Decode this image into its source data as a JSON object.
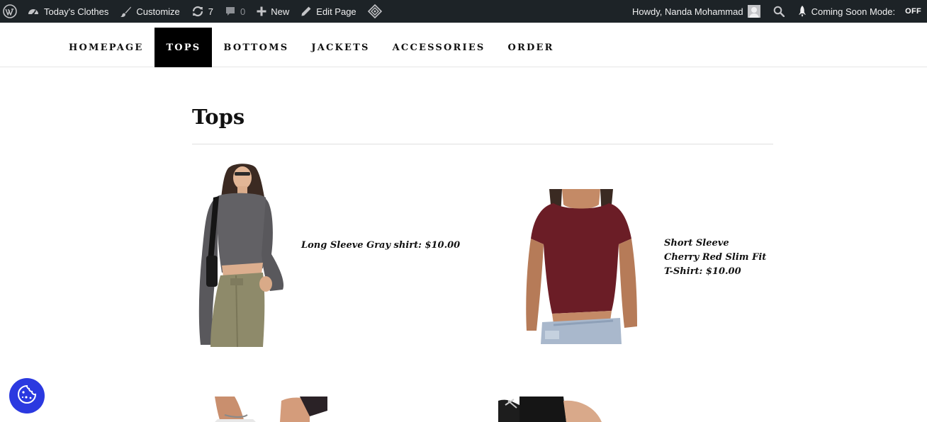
{
  "adminbar": {
    "wp_logo_icon": "wordpress-logo-icon",
    "site_name": "Today's Clothes",
    "customize": "Customize",
    "updates_count": "7",
    "comments_count": "0",
    "new_label": "New",
    "edit_page": "Edit Page",
    "greeting": "Howdy, Nanda Mohammad",
    "coming_soon": "Coming Soon Mode:",
    "coming_soon_state": "OFF",
    "colors": {
      "bar_bg": "#1d2327",
      "text": "#f0f0f1"
    }
  },
  "nav": {
    "items": [
      {
        "label": "HOMEPAGE",
        "active": false
      },
      {
        "label": "TOPS",
        "active": true
      },
      {
        "label": "BOTTOMS",
        "active": false
      },
      {
        "label": "JACKETS",
        "active": false
      },
      {
        "label": "ACCESSORIES",
        "active": false
      },
      {
        "label": "ORDER",
        "active": false
      }
    ]
  },
  "page": {
    "title": "Tops"
  },
  "products": [
    {
      "caption": "Long Sleeve Gray shirt: $10.00",
      "image": "model in long sleeve gray shirt and olive cargo pants"
    },
    {
      "caption": "Short Sleeve Cherry Red Slim Fit T-Shirt: $10.00",
      "image": "model in cherry red slim fit t-shirt and denim"
    },
    {
      "caption": "",
      "image": "model in white top (partially visible)"
    },
    {
      "caption": "",
      "image": "model in black cut-out top (partially visible)"
    }
  ],
  "cookie_button": {
    "icon": "cookie-icon",
    "color": "#2b39e0"
  }
}
